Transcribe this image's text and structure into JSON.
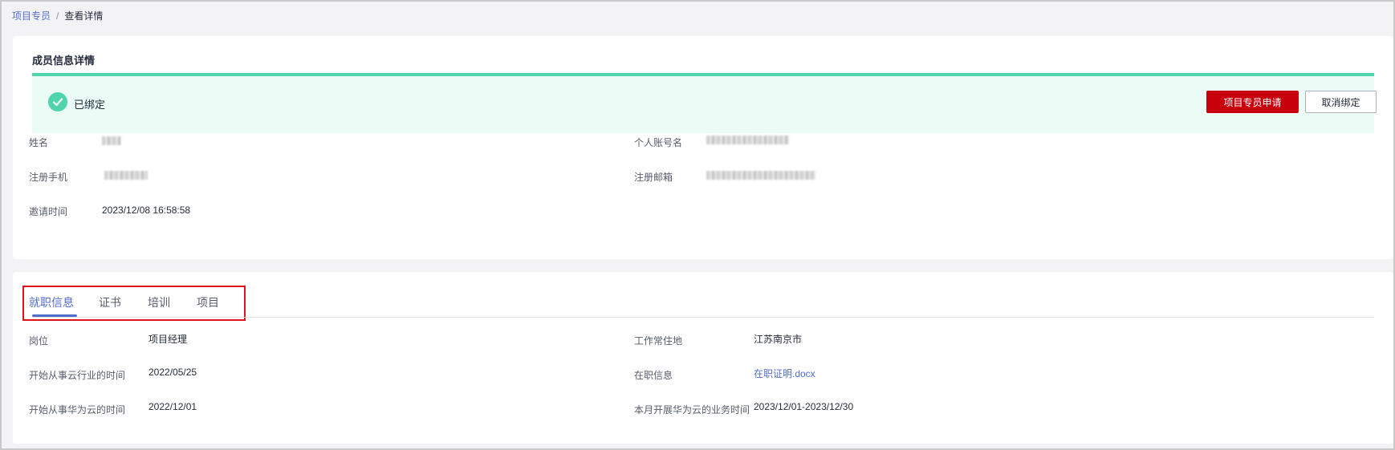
{
  "breadcrumb": {
    "parent": "项目专员",
    "separator": "/",
    "current": "查看详情"
  },
  "member_card": {
    "title": "成员信息详情",
    "status": {
      "icon": "check-circle-icon",
      "text": "已绑定",
      "color": "#50d4ab"
    },
    "buttons": {
      "apply": "项目专员申请",
      "unbind": "取消绑定"
    },
    "fields": {
      "name_label": "姓名",
      "account_label": "个人账号名",
      "phone_label": "注册手机",
      "email_label": "注册邮箱",
      "invite_time_label": "邀请时间",
      "invite_time_value": "2023/12/08 16:58:58"
    }
  },
  "employment_card": {
    "tabs": [
      "就职信息",
      "证书",
      "培训",
      "项目"
    ],
    "active_tab": "就职信息",
    "fields": {
      "position_label": "岗位",
      "position_value": "项目经理",
      "location_label": "工作常住地",
      "location_value": "江苏南京市",
      "cloud_start_label": "开始从事云行业的时间",
      "cloud_start_value": "2022/05/25",
      "employment_proof_label": "在职信息",
      "employment_proof_value": "在职证明.docx",
      "huawei_start_label": "开始从事华为云的时间",
      "huawei_start_value": "2022/12/01",
      "month_business_label": "本月开展华为云的业务时间",
      "month_business_value": "2023/12/01-2023/12/30"
    }
  },
  "colors": {
    "primary_button": "#c7000b",
    "link": "#526ecc",
    "status_bar_bg": "#ebfbf5",
    "highlight_box": "#e0131a"
  }
}
